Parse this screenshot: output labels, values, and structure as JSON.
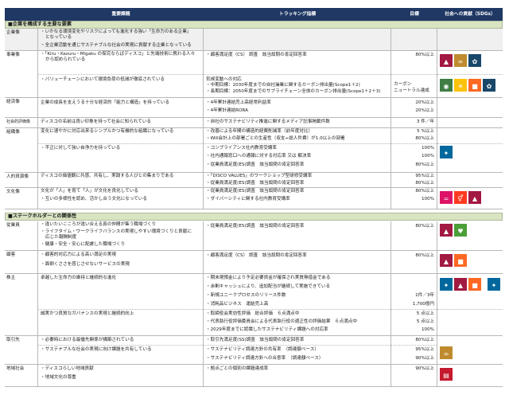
{
  "header": {
    "problem": "重要課題",
    "tracking": "トラッキング指標",
    "target": "目標",
    "sdgs": "社会への貢献（SDGs）"
  },
  "sections": {
    "one": "■企業を構成する主要な要素",
    "two": "■ステークホルダーとの関係性"
  },
  "rows": {
    "corp": {
      "cat": "企業像",
      "p1": "・いかなる環境変化やリスクによっても進化する強い「生命力のある企業」",
      "p2": "となっている",
      "p3": "・全企業活動を通じサステナブルな社会の実現に貢献する企業となっている"
    },
    "biz": {
      "cat": "事業像",
      "p1": "・「Kiru・Kezuru・Migaku の探究ならばディスコ」と先端技術に携わる人々",
      "p2": "から認められている",
      "t1": "・顧客満足度（CS） 調査　該当設問の肯定回答率",
      "g1": "80%以上",
      "p3": "・バリューチェーンにおいて環境負荷の低減が徹底されている",
      "t2": "気候変動への対応",
      "t3": "・中期目標：2030年度までの自社操業に関するカーボン排出量(Scope1＋2)",
      "t4": "・長期目標：2050年度までのサプライチェーン全体のカーボン排出量(Scope1＋2＋3)",
      "g2": "カーボン",
      "g3": "ニュートラル達成"
    },
    "econ": {
      "cat": "経済像",
      "p1": "企業の成長を支えうる十分な経済的「能力と構造」を持っている",
      "t1": "・4年累計連結売上高経常利益率",
      "g1": "20%以上",
      "t2": "・4年累計連結RORA",
      "g2": "20%以上"
    },
    "soc": {
      "cat": "社会的評価像",
      "p1": "ディスコの名前は良い印象を持って社会に知られている",
      "t1": "・自社のサステナビリティ推進に関するメディア記事掲載件数",
      "g1": "3 件／年"
    },
    "org": {
      "cat": "組織像",
      "p1": "変化に速やかに対応出来るシンプルかつ有機的な組織になっている",
      "t1": "・改善による年間の構造的経費削減率（前年度対比）",
      "g1": "5 %以上",
      "t2": "・Will会計上の部署ごとの生産性（収支÷総人件費）が1.0以上の部署",
      "g2": "80%以上",
      "p2": "・不正に対して強い自浄力を持っている",
      "t3": "・コンプライアンス社内教育受講率",
      "g3": "100%",
      "t4": "・社内通報窓口への通報に対する対応率 又は 解決率",
      "g4": "100%",
      "t5": "・従業員満足度(ES)調査　該当設問の肯定回答率",
      "g5": "80%以上"
    },
    "hr": {
      "cat": "人的資源像",
      "p1": "ディスコの価値観に共感、共有し、実践する人びとの集まりである",
      "t1": "・「DISCO VALUES」のワークショップ型研修受講率",
      "g1": "95%以上",
      "t2": "・従業員満足度(ES)調査　該当設問の肯定回答率",
      "g2": "80%以上"
    },
    "cult": {
      "cat": "文化像",
      "p1": "文化が「人」を育て「人」が文化を良化している",
      "p2": "・互いの多様性を認め、活かし合う文化になっている",
      "t1": "・従業員満足度(ES)調査　該当設問の肯定回答率",
      "g1": "80%以上",
      "t2": "・ダイバーシティに関する社内教育受講率",
      "g2": "100%"
    },
    "emp": {
      "cat": "従業員",
      "p1": "・違いたいこころが違い合える真の仲間が集う職場づくり",
      "p2": "・ライフタイム・ワークライフバランスの実現しやすい環境づくりと貢献に",
      "p3": "応じた報酬制度",
      "p4": "・健康・安全・安心に配慮した職場づくり",
      "t1": "・従業員満足度(ES)調査　該当設問の肯定回答率",
      "g1": "80%以上"
    },
    "cust": {
      "cat": "顧客",
      "p1": "・顧客的対応力による高い満足の実現",
      "p2": "・面倒くささを感じさせないサービスの実現",
      "t1": "・顧客満足度（CS） 調査　該当設問の肯定回答率",
      "g1": "80%以上"
    },
    "share": {
      "cat": "株主",
      "p1": "卓越した生命力の維持と継続的な進化",
      "t1": "・期末現預金により予定必要資金が確保され実質無借金である",
      "t2": "・余剰キャッシュにより、追加配当が継続して実施できている",
      "t3": "・新規ユニークプロセスのリリース件数",
      "g3": "1件／3年",
      "t4": "・消耗品ビジネス　運結売上高",
      "g4": "1,700億円",
      "p2": "誠実かつ良質なガバナンスの実現と継続的向上",
      "t5": "・取締役会実効性評価　総合評価　６点満点中",
      "g5": "5 点以上",
      "t6": "・代表執行役評価委員会による代表執行役の適正性の評価結果　６点満点中",
      "g6": "5 点以上",
      "t7": "・2029年度までに認識したサステナビリティ課題への対応率",
      "g7": "100%"
    },
    "supp": {
      "cat": "取引先",
      "p1": "・必要時における最優先関係が構築されている",
      "t1": "・取引先満足度(SS)調査　該当設問の肯定回答率",
      "g1": "80%以上",
      "p2": "・サステナブルな社会の実現に向け課題を共有している",
      "t2": "・サステナビリティ調達方針の共有率　（調達額ベース）",
      "g2": "95%以上",
      "t3": "・サステナビリティ調達方針への合意率　（調達額ベース）",
      "g3": "90%以上"
    },
    "local": {
      "cat": "地域社会",
      "p1": "・ディスコらしい地域貢献",
      "p2": "・地域文化の尊重",
      "t1": "・拠点ごとの個別の課題達成率",
      "g1": "90%以上"
    }
  },
  "sdg_colors": {
    "3": "#4c9f38",
    "4": "#c5192d",
    "5": "#ff3a21",
    "7": "#fcc30b",
    "8": "#a21942",
    "9": "#fd6925",
    "10": "#dd1367",
    "12": "#bf8b2e",
    "13": "#3f7e44",
    "16": "#00689d",
    "17": "#19486a"
  },
  "sdg_icons": {
    "3": "heartbeat-icon",
    "4": "book-icon",
    "5": "gender-icon",
    "7": "sun-icon",
    "8": "growth-chart-icon",
    "9": "cubes-icon",
    "10": "equality-icon",
    "12": "infinity-icon",
    "13": "eye-globe-icon",
    "16": "dove-icon",
    "17": "rings-icon"
  }
}
